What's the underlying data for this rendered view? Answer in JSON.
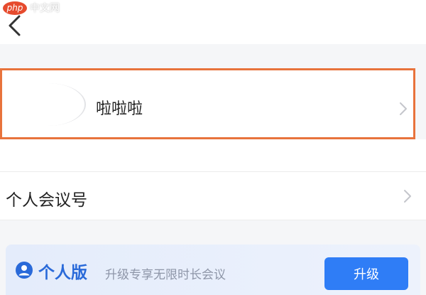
{
  "watermark": {
    "logo_text": "php",
    "site_text": "中文网"
  },
  "profile": {
    "name": "啦啦啦"
  },
  "meeting": {
    "label": "个人会议号"
  },
  "plan": {
    "label": "个人版",
    "description": "升级专享无限时长会议",
    "upgrade_label": "升级"
  },
  "colors": {
    "highlight_border": "#e8733c",
    "accent_blue": "#2f7df6",
    "plan_blue": "#2a6ad9"
  },
  "icons": {
    "back": "chevron-left-icon",
    "chevron": "chevron-right-icon",
    "person": "person-circle-icon"
  }
}
